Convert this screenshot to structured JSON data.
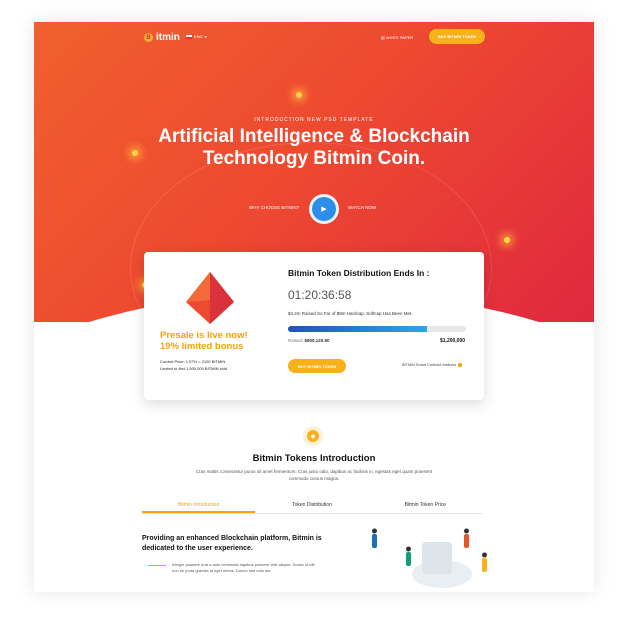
{
  "nav": {
    "logo": "itmin",
    "logo_mark": "B",
    "lang": "ENG",
    "white_paper": "WHITE PAPER",
    "buy": "BUY BITMIN TOKEN"
  },
  "hero": {
    "kicker": "INTRODUCTION NEW PSD TEMPLATE",
    "headline_1": "Artificial Intelligence & Blockchain",
    "headline_2": "Technology Bitmin Coin.",
    "why": "WHY CHOOSE BITMIN?",
    "watch": "WATCH NOW"
  },
  "sale": {
    "presale_1": "Presale is live now!",
    "presale_2": "19% limited bonus",
    "price_1": "Current Price: 1 ETH = 2100 BITMIN",
    "price_2": "Limited to first 1,500,000 BITMIN sold",
    "title": "Bitmin Token Distribution Ends In :",
    "countdown": "01:20:36:58",
    "raised_text": "$4.2m Raised So Far of $9m Hardcap. Softcap Has Been Met.",
    "progress": 0.78,
    "raised_label": "Raised:",
    "raised_value": "$900,120.90",
    "goal": "$1,200,000",
    "buy": "BUY BITMIN TOKEN",
    "contract": "BITMIN Smart Contract Address"
  },
  "tokens": {
    "title": "Bitmin Tokens Introduction",
    "subtitle": "Cras mattis consectetur purus sit amet fermentum. Cras justo odio, dapibus ac facilisis in, egestas eget quam praesent commodo cursus magna.",
    "tabs": [
      "Bitmin Introduction",
      "Token Distribution",
      "Bitmin Token Price"
    ]
  },
  "intro": {
    "heading": "Providing an enhanced Blockchain platform, Bitmin is dedicated to the user experience.",
    "body": "Integer posuere erat a ante venenatis dapibus posuere velit aliquet. Donec id elit non mi porta gravida at eget metus. Donec sed odio dui."
  },
  "colors": {
    "accent": "#f7b21b",
    "hero_start": "#f0602e",
    "hero_end": "#e0283f",
    "progress": "#2ba6e8"
  }
}
